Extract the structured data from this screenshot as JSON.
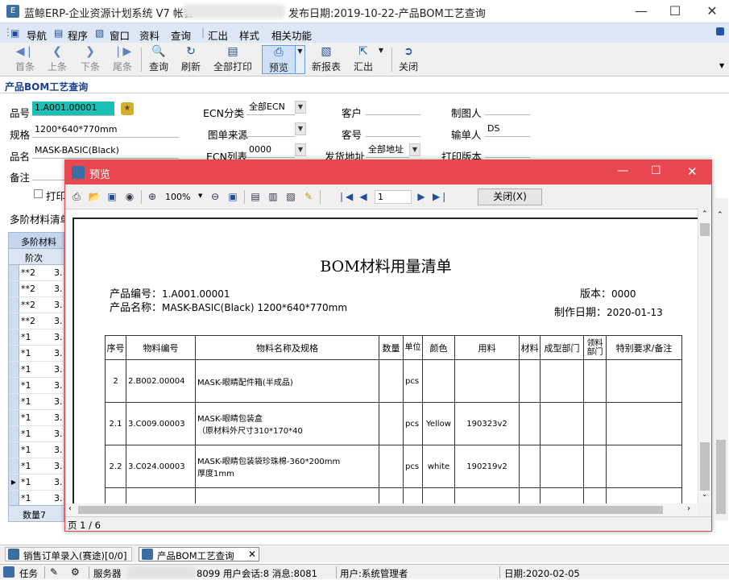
{
  "window": {
    "title_prefix": "蓝鲸ERP-企业资源计划系统 V7 帐套",
    "title_suffix": "发布日期:2019-10-22-产品BOM工艺查询"
  },
  "menu": [
    "导航",
    "程序",
    "窗口",
    "资料",
    "查询",
    "汇出",
    "样式",
    "相关功能"
  ],
  "toolbar": {
    "first": "首条",
    "prev": "上条",
    "next": "下条",
    "last": "尾条",
    "query": "查询",
    "refresh": "刷新",
    "print_all": "全部打印",
    "preview": "预览",
    "new_report": "新报表",
    "export": "汇出",
    "close": "关闭"
  },
  "form": {
    "heading": "产品BOM工艺查询",
    "part_no_label": "品号",
    "part_no": "1.A001.00001",
    "spec_label": "规格",
    "spec": "1200*640*770mm",
    "name_label": "品名",
    "name": "MASK-BASIC(Black)",
    "remark_label": "备注",
    "ecn_class_label": "ECN分类",
    "ecn_class": "全部ECN",
    "drawing_source_label": "图单来源",
    "ecn_list_label": "ECN列表",
    "ecn_list": "0000",
    "customer_label": "客户",
    "customer_no_label": "客号",
    "ship_addr_label": "发货地址",
    "ship_addr": "全部地址",
    "drafter_label": "制图人",
    "input_by_label": "输单人",
    "input_by": "DS",
    "print_version_label": "打印版本",
    "print_check": "打印",
    "multi_level_label": "多阶材料清单"
  },
  "grid": {
    "header1": "多阶材料",
    "header2": "阶次",
    "rows": [
      {
        "level": "**2",
        "v": "3."
      },
      {
        "level": "**2",
        "v": "3."
      },
      {
        "level": "**2",
        "v": "3."
      },
      {
        "level": "**2",
        "v": "3."
      },
      {
        "level": "*1",
        "v": "3."
      },
      {
        "level": "*1",
        "v": "3."
      },
      {
        "level": "*1",
        "v": "3."
      },
      {
        "level": "*1",
        "v": "3."
      },
      {
        "level": "*1",
        "v": "3."
      },
      {
        "level": "*1",
        "v": "3."
      },
      {
        "level": "*1",
        "v": "3."
      },
      {
        "level": "*1",
        "v": "3."
      },
      {
        "level": "*1",
        "v": "3."
      },
      {
        "level": "*1",
        "v": "3."
      },
      {
        "level": "*1",
        "v": "3."
      }
    ],
    "count_label": "数量7"
  },
  "preview": {
    "title": "预览",
    "zoom": "100%",
    "page_input": "1",
    "close_btn": "关闭(X)",
    "page_status": "页 1 / 6",
    "report": {
      "title": "BOM材料用量清单",
      "product_no_label": "产品编号：",
      "product_no": "1.A001.00001",
      "product_name_label": "产品名称：",
      "product_name": "MASK-BASIC(Black) 1200*640*770mm",
      "version_label": "版本：",
      "version": "0000",
      "date_label": "制作日期：",
      "date": "2020-01-13",
      "columns": [
        "序号",
        "物料编号",
        "物料名称及规格",
        "数量",
        "单位",
        "颜色",
        "用料",
        "材料",
        "成型部门",
        "领料部门",
        "特别要求/备注"
      ],
      "rows": [
        {
          "seq": "2",
          "code": "2.B002.00004",
          "name1": "MASK-眼睛配件箱(半成品)",
          "name2": "",
          "qty": "",
          "unit": "pcs",
          "color": "",
          "material": "",
          "mat": "",
          "dept": "",
          "pick": "",
          "note": ""
        },
        {
          "seq": "2.1",
          "code": "3.C009.00003",
          "name1": "MASK-眼睛包装盒",
          "name2": "（原材料外尺寸310*170*40",
          "qty": "",
          "unit": "pcs",
          "color": "Yellow",
          "material": "190323v2",
          "mat": "",
          "dept": "",
          "pick": "",
          "note": ""
        },
        {
          "seq": "2.2",
          "code": "3.C024.00003",
          "name1": "MASK-眼睛包装袋珍珠棉-360*200mm",
          "name2": "厚度1mm",
          "qty": "",
          "unit": "pcs",
          "color": "white",
          "material": "190219v2",
          "mat": "",
          "dept": "",
          "pick": "",
          "note": ""
        }
      ]
    }
  },
  "tabs": [
    "销售订单录入(赛途)[0/0]",
    "产品BOM工艺查询"
  ],
  "status": {
    "tasks": "任务",
    "service": "服务器",
    "users": "8099 用户会话:8 消息:8081",
    "user": "用户:系统管理者",
    "date": "日期:2020-02-05"
  }
}
